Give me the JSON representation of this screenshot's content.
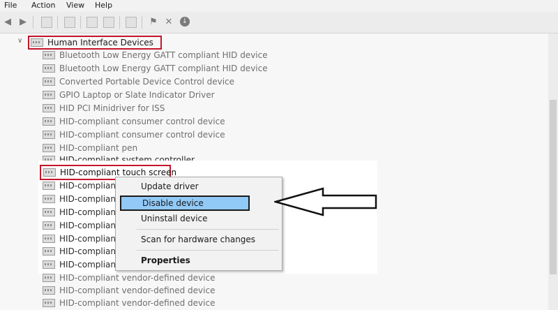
{
  "menubar": {
    "file": "File",
    "action": "Action",
    "view": "View",
    "help": "Help"
  },
  "toolbar": {
    "back_icon": "back-arrow-icon",
    "forward_icon": "forward-arrow-icon",
    "remove_icon": "✕",
    "update_icon": "↓"
  },
  "tree": {
    "category": "Human Interface Devices",
    "devices_faded_top": [
      "Bluetooth Low Energy GATT compliant HID device",
      "Bluetooth Low Energy GATT compliant HID device",
      "Converted Portable Device Control device",
      "GPIO Laptop or Slate Indicator Driver",
      "HID PCI Minidriver for ISS",
      "HID-compliant consumer control device",
      "HID-compliant consumer control device",
      "HID-compliant pen",
      "HID-compliant system controller"
    ],
    "selected_device": "HID-compliant touch screen",
    "devices_under_menu": [
      "HID-compliant",
      "HID-compliant",
      "HID-compliant",
      "HID-compliant",
      "HID-compliant",
      "HID-compliant",
      "HID-compliant"
    ],
    "devices_faded_bottom": [
      "HID-compliant vendor-defined device",
      "HID-compliant vendor-defined device",
      "HID-compliant vendor-defined device"
    ]
  },
  "context_menu": {
    "update_driver": "Update driver",
    "disable_device": "Disable device",
    "uninstall_device": "Uninstall device",
    "scan_hardware": "Scan for hardware changes",
    "properties": "Properties"
  },
  "colors": {
    "highlight_border": "#c4152a",
    "menu_hover": "#91c9f7"
  }
}
